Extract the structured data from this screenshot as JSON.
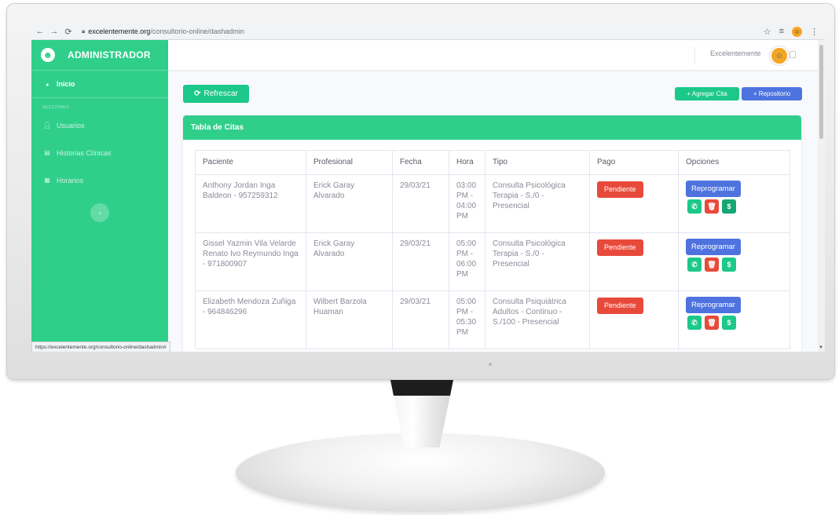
{
  "browser": {
    "url_host": "excelentemente.org",
    "url_path": "/consultorio-online/dashadmin",
    "status_url": "https://excelentemente.org/consultorio-online/dashadmin#"
  },
  "sidebar": {
    "brand": "ADMINISTRADOR",
    "inicio": "Inicio",
    "section_heading": "SECCIONES",
    "items": [
      {
        "label": "Usuarios",
        "icon": "users-icon"
      },
      {
        "label": "Historias Clínicas",
        "icon": "file-icon"
      },
      {
        "label": "Horarios",
        "icon": "calendar-icon"
      }
    ]
  },
  "topbar": {
    "user_name": "Excelentemente"
  },
  "toolbar": {
    "refresh_label": "Refrescar",
    "add_label": "+ Agregar Cita",
    "repo_label": "+ Repositorio"
  },
  "card": {
    "title": "Tabla de Citas",
    "columns": [
      "Paciente",
      "Profesional",
      "Fecha",
      "Hora",
      "Tipo",
      "Pago",
      "Opciones"
    ],
    "rows": [
      {
        "paciente": "Anthony Jordan Inga Baldeon - 957259312",
        "profesional": "Erick Garay Alvarado",
        "fecha": "29/03/21",
        "hora": "03:00 PM - 04:00 PM",
        "tipo": "Consulta Psicológica Terapia - S./0 - Presencial",
        "pago": "Pendiente",
        "opcion": "Reprogramar"
      },
      {
        "paciente": "Gissel Yazmin Vila Velarde Renato Ivo Reymundo Inga - 971800907",
        "profesional": "Erick Garay Alvarado",
        "fecha": "29/03/21",
        "hora": "05:00 PM - 06:00 PM",
        "tipo": "Consulta Psicológica Terapia - S./0 - Presencial",
        "pago": "Pendiente",
        "opcion": "Reprogramar"
      },
      {
        "paciente": "Elizabeth Mendoza Zuñiga - 964846296",
        "profesional": "Wilbert Barzola Huaman",
        "fecha": "29/03/21",
        "hora": "05:00 PM - 05:30 PM",
        "tipo": "Consulta Psiquiátrica Adultos - Continuo - S./100 - Presencial",
        "pago": "Pendiente",
        "opcion": "Reprogramar"
      }
    ]
  },
  "colors": {
    "sidebar": "#2fcf8a",
    "success": "#1cc88a",
    "primary": "#4e73df",
    "danger": "#e74a3b"
  }
}
